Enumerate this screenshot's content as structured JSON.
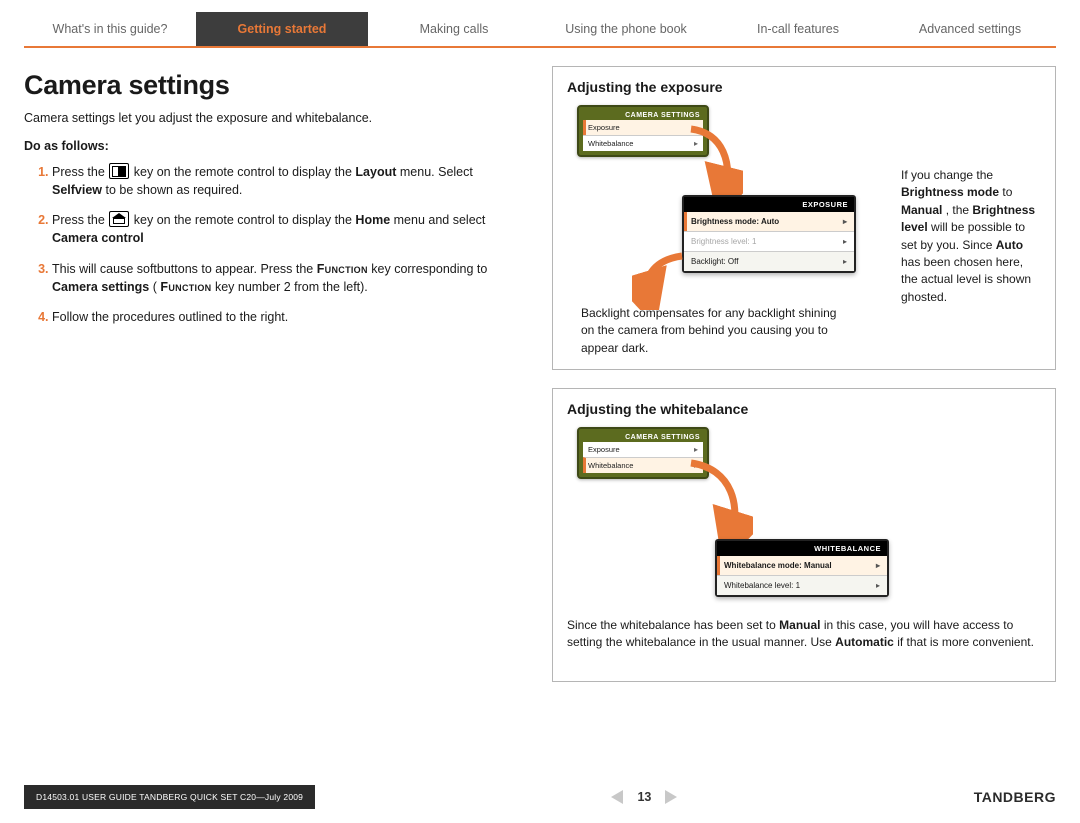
{
  "nav": {
    "tabs": [
      {
        "label": "What's in this guide?"
      },
      {
        "label": "Getting started",
        "active": true
      },
      {
        "label": "Making calls"
      },
      {
        "label": "Using the phone book"
      },
      {
        "label": "In-call features"
      },
      {
        "label": "Advanced settings"
      }
    ]
  },
  "left": {
    "title": "Camera settings",
    "intro": "Camera settings let you adjust the exposure and whitebalance.",
    "do_follows": "Do as follows:",
    "steps": {
      "s1a": "Press the ",
      "s1b": " key on the remote control to display the ",
      "s1_bold1": "Layout",
      "s1c": " menu. Select ",
      "s1_bold2": "Selfview",
      "s1d": " to be shown as required.",
      "s2a": "Press the ",
      "s2b": " key on the remote control to display the ",
      "s2_bold1": "Home",
      "s2c": " menu and select ",
      "s2_bold2": "Camera control",
      "s3a": "This will cause softbuttons to appear. Press the ",
      "s3_sc1": "Function",
      "s3b": " key corresponding to ",
      "s3_bold1": "Camera settings",
      "s3c": " (",
      "s3_sc2": "Function",
      "s3d": " key number 2 from the left).",
      "s4": "Follow the procedures outlined to the right."
    }
  },
  "panel1": {
    "heading": "Adjusting the exposure",
    "screen": {
      "title": "CAMERA SETTINGS",
      "rows": [
        "Exposure",
        "Whitebalance"
      ]
    },
    "popup": {
      "title": "EXPOSURE",
      "rows": [
        {
          "label": "Brightness mode:",
          "value": "Auto",
          "first": true
        },
        {
          "label": "Brightness level:",
          "value": "1",
          "ghost": true
        },
        {
          "label": "Backlight:",
          "value": "Off",
          "alt": true
        }
      ]
    },
    "side": {
      "a": "If you change the ",
      "b1": "Brightness mode",
      "c": " to ",
      "b2": "Manual",
      "d": ", the ",
      "b3": "Brightness level",
      "e": " will be possible to set by you. Since ",
      "b4": "Auto",
      "f": " has been chosen here, the actual level is shown ghosted."
    },
    "bottom": "Backlight compensates for any backlight shining on the camera from behind you causing you to appear dark."
  },
  "panel2": {
    "heading": "Adjusting the whitebalance",
    "screen": {
      "title": "CAMERA SETTINGS",
      "rows": [
        "Exposure",
        "Whitebalance"
      ]
    },
    "popup": {
      "title": "WHITEBALANCE",
      "rows": [
        {
          "label": "Whitebalance mode:",
          "value": "Manual",
          "first": true
        },
        {
          "label": "Whitebalance level:",
          "value": "1",
          "alt": true
        }
      ]
    },
    "bottom": {
      "a": "Since the whitebalance has been set to ",
      "b1": "Manual",
      "c": " in this case, you will have access to setting the whitebalance in the usual manner. Use ",
      "b2": "Automatic",
      "d": " if that is more convenient."
    }
  },
  "footer": {
    "left": "D14503.01 USER GUIDE TANDBERG QUICK SET C20—July 2009",
    "page": "13",
    "brand": "TANDBERG"
  }
}
